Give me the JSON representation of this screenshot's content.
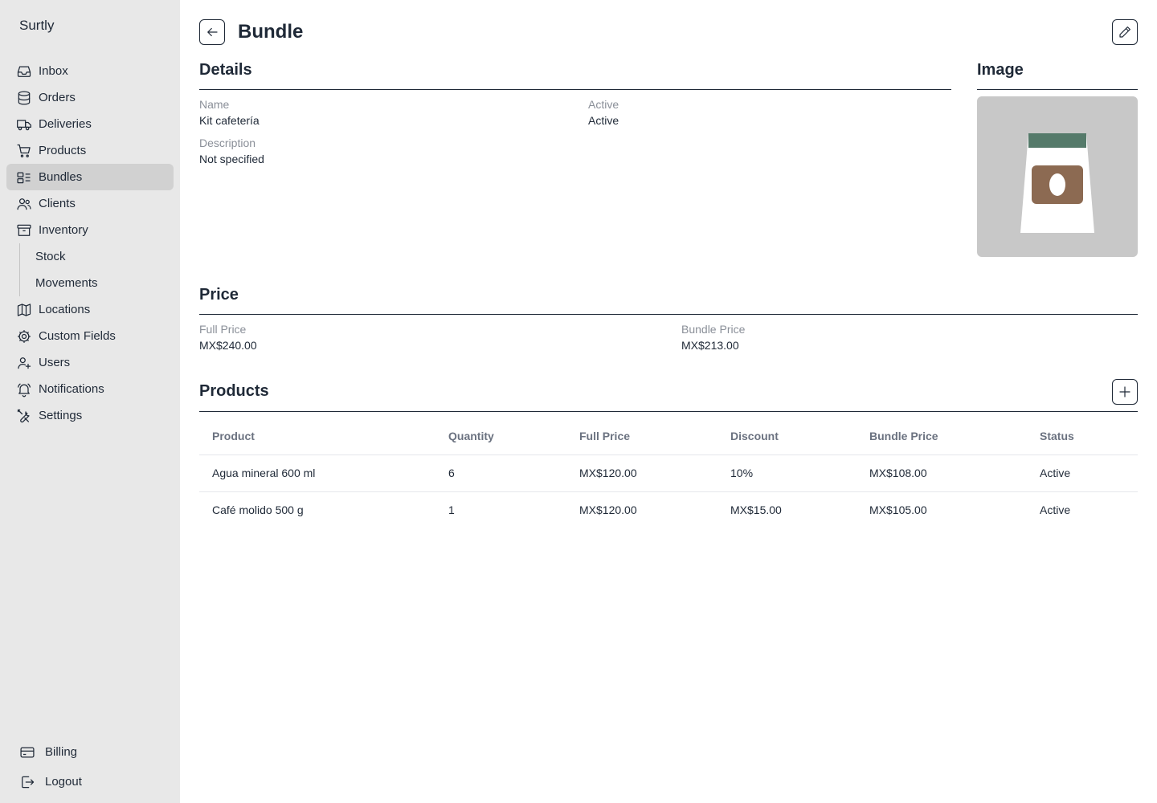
{
  "brand": "Surtly",
  "nav": {
    "items": [
      {
        "label": "Inbox",
        "icon": "inbox-icon"
      },
      {
        "label": "Orders",
        "icon": "database-icon"
      },
      {
        "label": "Deliveries",
        "icon": "truck-icon"
      },
      {
        "label": "Products",
        "icon": "cart-icon"
      },
      {
        "label": "Bundles",
        "icon": "bundle-icon"
      },
      {
        "label": "Clients",
        "icon": "users-icon"
      },
      {
        "label": "Inventory",
        "icon": "archive-icon"
      }
    ],
    "inventory_sub": [
      {
        "label": "Stock"
      },
      {
        "label": "Movements"
      }
    ],
    "items_after": [
      {
        "label": "Locations",
        "icon": "map-icon"
      },
      {
        "label": "Custom Fields",
        "icon": "gear-icon"
      },
      {
        "label": "Users",
        "icon": "user-plus-icon"
      },
      {
        "label": "Notifications",
        "icon": "bell-icon"
      },
      {
        "label": "Settings",
        "icon": "tools-icon"
      }
    ],
    "bottom": [
      {
        "label": "Billing",
        "icon": "credit-card-icon"
      },
      {
        "label": "Logout",
        "icon": "logout-icon"
      }
    ],
    "active": "Bundles"
  },
  "page": {
    "title": "Bundle"
  },
  "details": {
    "title": "Details",
    "name_label": "Name",
    "name_value": "Kit cafetería",
    "active_label": "Active",
    "active_value": "Active",
    "description_label": "Description",
    "description_value": "Not specified"
  },
  "image": {
    "title": "Image",
    "colors": {
      "bag": "#ffffff",
      "band": "#557a6a",
      "label": "#8c6a52"
    }
  },
  "price": {
    "title": "Price",
    "full_label": "Full Price",
    "full_value": "MX$240.00",
    "bundle_label": "Bundle Price",
    "bundle_value": "MX$213.00"
  },
  "products": {
    "title": "Products",
    "columns": [
      "Product",
      "Quantity",
      "Full Price",
      "Discount",
      "Bundle Price",
      "Status"
    ],
    "rows": [
      [
        "Agua mineral 600 ml",
        "6",
        "MX$120.00",
        "10%",
        "MX$108.00",
        "Active"
      ],
      [
        "Café molido 500 g",
        "1",
        "MX$120.00",
        "MX$15.00",
        "MX$105.00",
        "Active"
      ]
    ]
  }
}
